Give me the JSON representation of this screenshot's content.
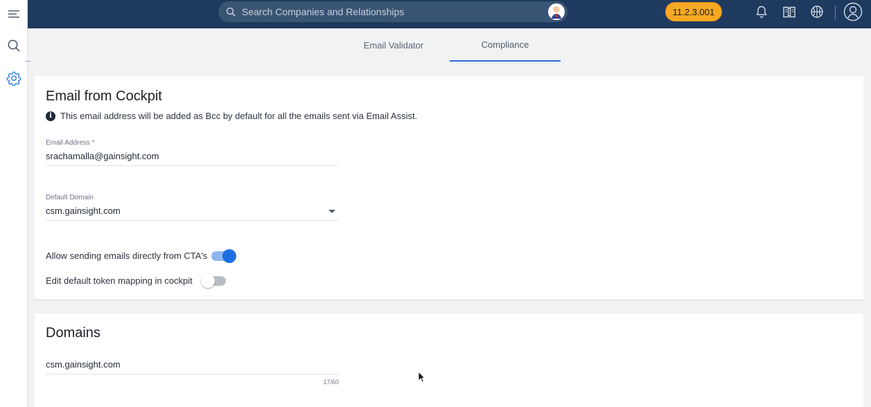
{
  "search": {
    "placeholder": "Search Companies and Relationships"
  },
  "header": {
    "version_badge": "11.2.3.001"
  },
  "tabs": [
    {
      "label": "Email Validator",
      "active": false
    },
    {
      "label": "Compliance",
      "active": true
    }
  ],
  "email_card": {
    "title": "Email from Cockpit",
    "info_text": "This email address will be added as Bcc by default for all the emails sent via Email Assist.",
    "email_label": "Email Address *",
    "email_value": "srachamalla@gainsight.com",
    "domain_label": "Default Domain",
    "domain_value": "csm.gainsight.com",
    "toggle_cta_label": "Allow sending emails directly from CTA's",
    "toggle_cta_on": true,
    "toggle_token_label": "Edit default token mapping in cockpit",
    "toggle_token_on": false
  },
  "domains_card": {
    "title": "Domains",
    "domain_value": "csm.gainsight.com",
    "char_counter": "17/60"
  },
  "colors": {
    "topbar": "#1e3a5f",
    "accent": "#2a6fd6",
    "version_badge": "#f6a823",
    "toggle_on": "#1d6fe0"
  },
  "icons": {
    "rail": [
      "hamburger-menu-icon",
      "search-icon",
      "gear-icon"
    ],
    "topbar": [
      "bell-icon",
      "book-icon",
      "basketball-icon",
      "user-profile-icon"
    ]
  }
}
